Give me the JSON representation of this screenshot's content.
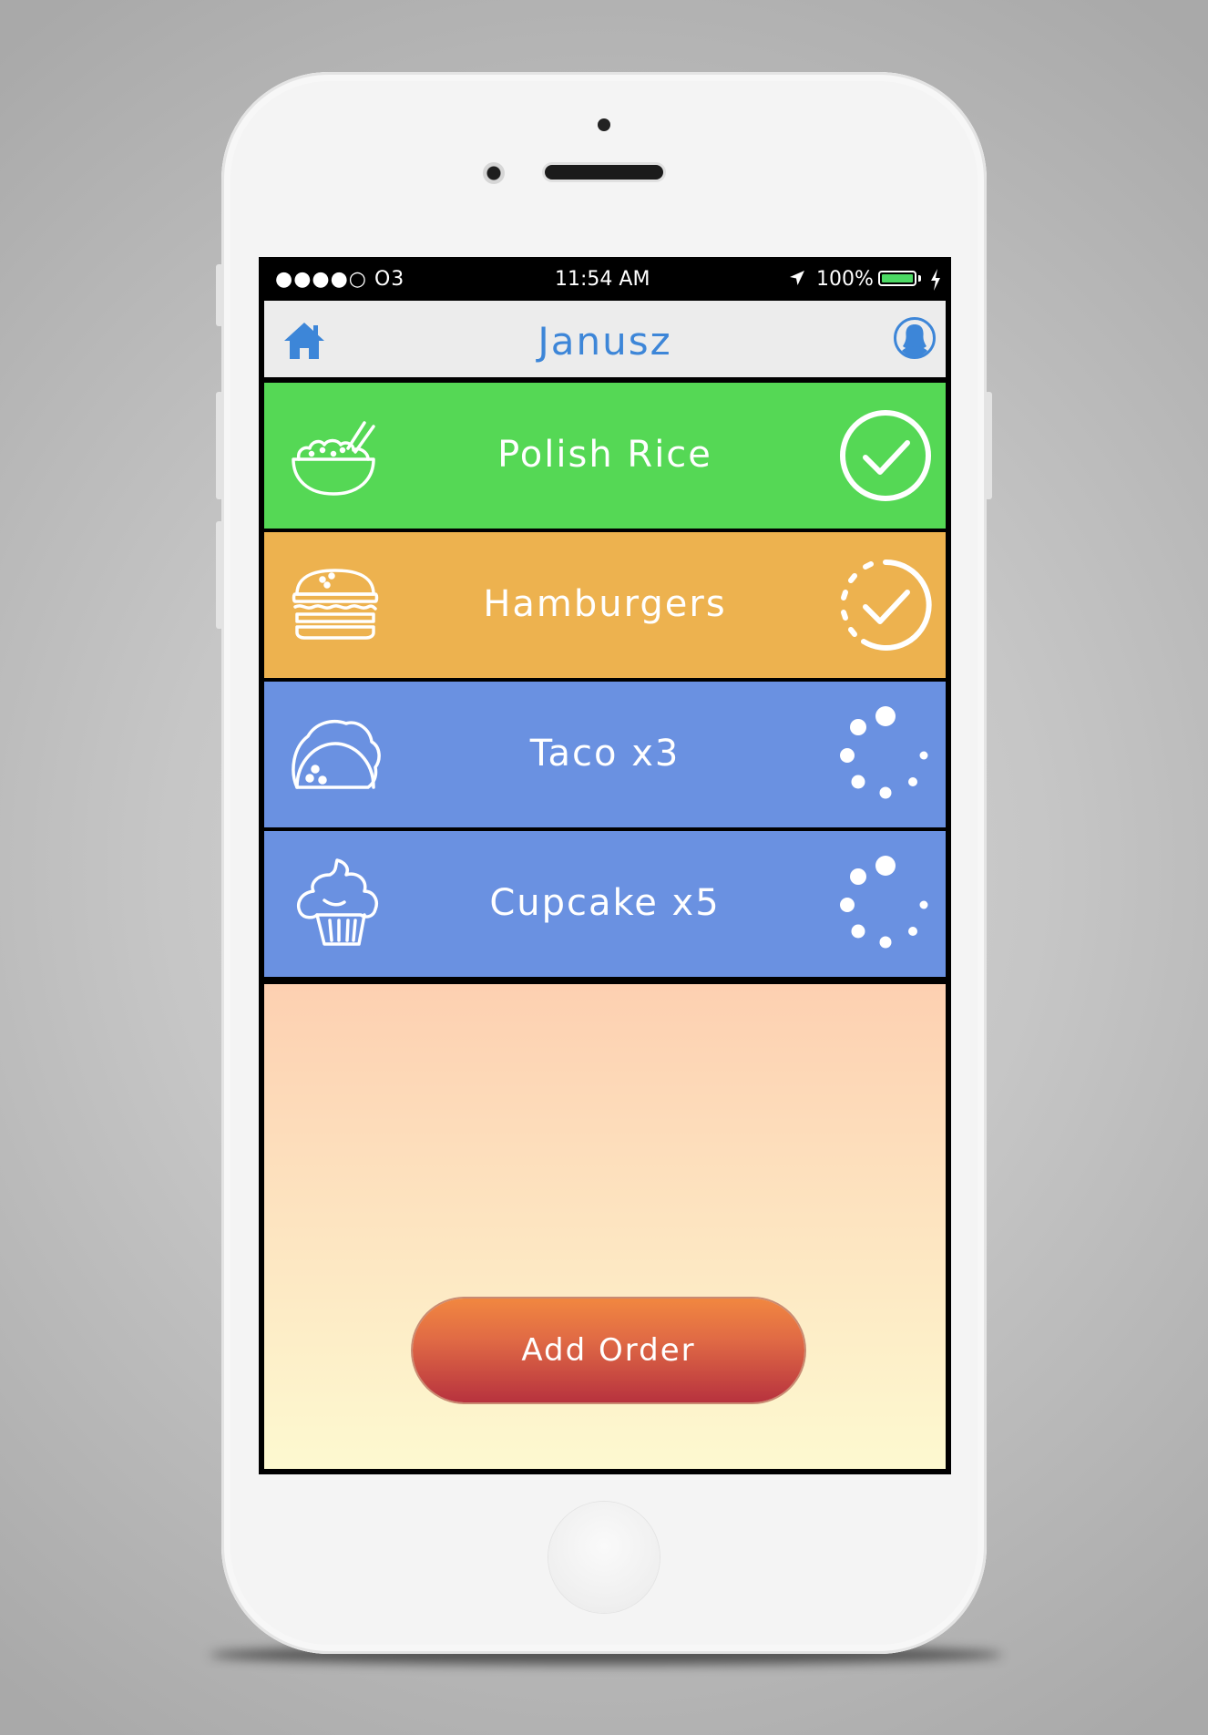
{
  "status_bar": {
    "carrier": "●●●●○ O3",
    "time": "11:54 AM",
    "battery": "100%",
    "battery_level": 1.0
  },
  "header": {
    "title": "Janusz",
    "home_icon": "home-icon",
    "profile_icon": "profile-icon"
  },
  "orders": [
    {
      "label": "Polish Rice",
      "food_icon": "rice-bowl-icon",
      "status": "completed",
      "status_icon": "check-circle-icon",
      "color": "#55d855"
    },
    {
      "label": "Hamburgers",
      "food_icon": "hamburger-icon",
      "status": "ready",
      "status_icon": "dashed-check-circle-icon",
      "color": "#edb24f"
    },
    {
      "label": "Taco x3",
      "food_icon": "taco-icon",
      "status": "in-progress",
      "status_icon": "loading-spinner-icon",
      "color": "#6a91e1"
    },
    {
      "label": "Cupcake x5",
      "food_icon": "cupcake-icon",
      "status": "in-progress",
      "status_icon": "loading-spinner-icon",
      "color": "#6a91e1"
    }
  ],
  "add_button": {
    "label": "Add Order"
  },
  "colors": {
    "accent": "#3d86d8",
    "nav_bg": "#ececec",
    "button_top": "#f18740",
    "button_bottom": "#b7323e"
  }
}
